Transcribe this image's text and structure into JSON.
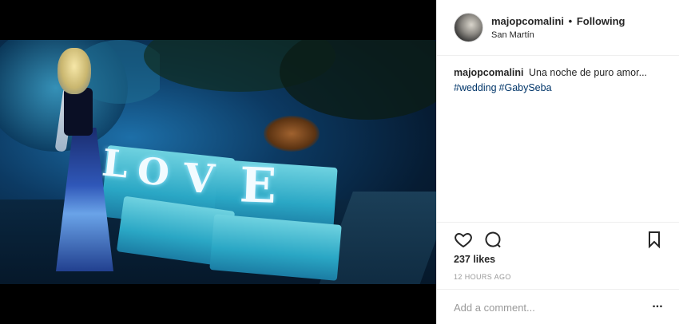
{
  "post": {
    "username": "majopcomalini",
    "separator": "•",
    "follow_status": "Following",
    "location": "San Martín",
    "caption": {
      "author": "majopcomalini",
      "text": "Una noche de puro amor...",
      "hashtags": [
        "#wedding",
        "#GabySeba"
      ]
    },
    "photo": {
      "letters": [
        "L",
        "O",
        "V",
        "E"
      ]
    },
    "likes": "237 likes",
    "timestamp": "12 HOURS AGO",
    "comment_placeholder": "Add a comment...",
    "more_label": "..."
  },
  "icons": {
    "like": "heart-icon",
    "comment": "comment-icon",
    "save": "bookmark-icon",
    "more": "more-options-icon"
  }
}
